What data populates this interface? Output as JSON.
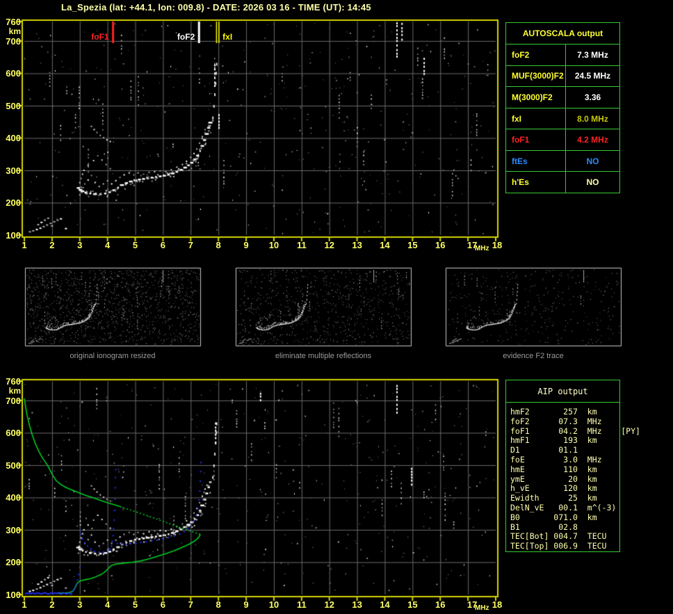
{
  "title": "La_Spezia (lat: +44.1, lon: 009.8) - DATE: 2026 03 16 - TIME (UT): 14:45",
  "palette": {
    "background": "#000000",
    "title_text": "#ffffa8",
    "axis_text": "#ffff66",
    "plot_border": "#d4d400",
    "grid": "#6b6b6b",
    "table_border": "#33cc33",
    "trace_white": "#ffffff",
    "profile_green": "#00cc22",
    "restored_blue": "#2233ff",
    "foF1_red": "#ff2222",
    "ftEs_blue": "#2d8cff"
  },
  "autoscala": {
    "title": "AUTOSCALA output",
    "rows": [
      {
        "label": "foF2",
        "value": "7.3 MHz",
        "label_color": "#ffff33",
        "value_color": "#ffffff"
      },
      {
        "label": "MUF(3000)F2",
        "value": "24.5 MHz",
        "label_color": "#ffff33",
        "value_color": "#ffffff"
      },
      {
        "label": "M(3000)F2",
        "value": "3.36",
        "label_color": "#ffff33",
        "value_color": "#ffffff"
      },
      {
        "label": "fxI",
        "value": "8.0 MHz",
        "label_color": "#ffff33",
        "value_color": "#c8c800"
      },
      {
        "label": "foF1",
        "value": "4.2 MHz",
        "label_color": "#ff2222",
        "value_color": "#ff2222"
      },
      {
        "label": "ftEs",
        "value": "NO",
        "label_color": "#2d8cff",
        "value_color": "#2d8cff"
      },
      {
        "label": "h'Es",
        "value": "NO",
        "label_color": "#ffff33",
        "value_color": "#ffffaa"
      }
    ]
  },
  "aip": {
    "title": "AIP output",
    "rows": [
      {
        "label": "hmF2",
        "value": "257",
        "unit": "km",
        "extra": ""
      },
      {
        "label": "foF2",
        "value": "07.3",
        "unit": "MHz",
        "extra": ""
      },
      {
        "label": "foF1",
        "value": "04.2",
        "unit": "MHz",
        "extra": "[PY]"
      },
      {
        "label": "hmF1",
        "value": "193",
        "unit": "km",
        "extra": ""
      },
      {
        "label": "D1",
        "value": "01.1",
        "unit": "",
        "extra": ""
      },
      {
        "label": "foE",
        "value": "3.0",
        "unit": "MHz",
        "extra": ""
      },
      {
        "label": "hmE",
        "value": "110",
        "unit": "km",
        "extra": ""
      },
      {
        "label": "ymE",
        "value": "20",
        "unit": "km",
        "extra": ""
      },
      {
        "label": "h_vE",
        "value": "120",
        "unit": "km",
        "extra": ""
      },
      {
        "label": "Ewidth",
        "value": "25",
        "unit": "km",
        "extra": ""
      },
      {
        "label": "DelN_vE",
        "value": "00.1",
        "unit": "m^(-3)",
        "extra": ""
      },
      {
        "label": "B0",
        "value": "071.0",
        "unit": "km",
        "extra": ""
      },
      {
        "label": "B1",
        "value": "02.8",
        "unit": "",
        "extra": ""
      },
      {
        "label": "TEC[Bot]",
        "value": "004.7",
        "unit": "TECU",
        "extra": ""
      },
      {
        "label": "TEC[Top]",
        "value": "006.9",
        "unit": "TECU",
        "extra": ""
      }
    ]
  },
  "thumbnails": [
    {
      "caption": "original ionogram resized",
      "noise_level": "high"
    },
    {
      "caption": "eliminate multiple reflections",
      "noise_level": "medium"
    },
    {
      "caption": "evidence F2 trace",
      "noise_level": "low"
    }
  ],
  "chart_data": [
    {
      "id": "top-ionogram",
      "type": "scatter",
      "title": "",
      "xlabel": "MHz",
      "ylabel": "km",
      "xlim": [
        1,
        18
      ],
      "ylim": [
        100,
        760
      ],
      "grid": true,
      "xticks": [
        "1",
        "2",
        "3",
        "4",
        "5",
        "6",
        "7",
        "8",
        "9",
        "10",
        "11",
        "12",
        "13",
        "14",
        "15",
        "16",
        "17",
        "18"
      ],
      "yticks": [
        "760",
        "700",
        "600",
        "500",
        "400",
        "300",
        "200",
        "100"
      ],
      "markers": [
        {
          "label": "foF1",
          "x": 4.2,
          "color": "#ff2222"
        },
        {
          "label": "foF2",
          "x": 7.3,
          "color": "#ffffff"
        },
        {
          "label": "fxI",
          "x": 8.0,
          "color": "#ffff00"
        }
      ],
      "trace_f": [
        [
          2.95,
          246
        ],
        [
          3.02,
          240
        ],
        [
          3.1,
          236
        ],
        [
          3.22,
          232
        ],
        [
          3.38,
          229
        ],
        [
          3.55,
          227
        ],
        [
          3.75,
          227
        ],
        [
          3.92,
          229
        ],
        [
          4.08,
          233
        ],
        [
          4.22,
          239
        ],
        [
          4.38,
          247
        ],
        [
          4.52,
          255
        ],
        [
          4.68,
          261
        ],
        [
          4.84,
          266
        ],
        [
          5.0,
          270
        ],
        [
          5.15,
          272
        ],
        [
          5.3,
          274
        ],
        [
          5.45,
          276
        ],
        [
          5.6,
          278
        ],
        [
          5.75,
          280
        ],
        [
          5.9,
          282
        ],
        [
          6.05,
          284
        ],
        [
          6.2,
          287
        ],
        [
          6.35,
          291
        ],
        [
          6.5,
          296
        ],
        [
          6.65,
          302
        ],
        [
          6.8,
          309
        ],
        [
          6.92,
          316
        ],
        [
          7.04,
          324
        ],
        [
          7.15,
          334
        ],
        [
          7.25,
          346
        ],
        [
          7.34,
          360
        ],
        [
          7.42,
          376
        ],
        [
          7.5,
          394
        ],
        [
          7.58,
          413
        ],
        [
          7.65,
          432
        ],
        [
          7.71,
          448
        ]
      ],
      "trace_spread": [
        [
          3.0,
          262
        ],
        [
          3.05,
          275
        ],
        [
          3.1,
          288
        ],
        [
          3.18,
          258
        ],
        [
          3.3,
          270
        ],
        [
          3.42,
          284
        ],
        [
          3.55,
          262
        ],
        [
          3.7,
          250
        ],
        [
          3.85,
          258
        ],
        [
          4.0,
          268
        ],
        [
          4.15,
          258
        ],
        [
          4.3,
          268
        ],
        [
          4.45,
          278
        ],
        [
          4.6,
          286
        ],
        [
          4.78,
          292
        ],
        [
          4.95,
          286
        ],
        [
          5.1,
          292
        ],
        [
          5.3,
          288
        ],
        [
          5.5,
          294
        ],
        [
          5.7,
          296
        ],
        [
          5.9,
          298
        ],
        [
          6.1,
          296
        ],
        [
          6.3,
          302
        ],
        [
          6.5,
          310
        ],
        [
          6.7,
          318
        ],
        [
          6.85,
          328
        ],
        [
          7.0,
          340
        ],
        [
          7.12,
          352
        ],
        [
          7.22,
          366
        ],
        [
          7.32,
          384
        ],
        [
          7.42,
          404
        ],
        [
          7.52,
          426
        ],
        [
          3.15,
          300
        ],
        [
          3.3,
          315
        ],
        [
          3.5,
          330
        ],
        [
          3.65,
          345
        ],
        [
          3.8,
          332
        ],
        [
          3.95,
          318
        ],
        [
          4.1,
          305
        ]
      ],
      "trace_arc": [
        [
          3.42,
          436
        ],
        [
          3.52,
          426
        ],
        [
          3.62,
          417
        ],
        [
          3.74,
          408
        ],
        [
          3.86,
          401
        ],
        [
          3.98,
          394
        ],
        [
          4.1,
          389
        ]
      ],
      "trace_e": [
        [
          1.2,
          110
        ],
        [
          1.32,
          113
        ],
        [
          1.45,
          117
        ],
        [
          1.58,
          121
        ],
        [
          1.7,
          126
        ],
        [
          1.82,
          131
        ],
        [
          1.95,
          136
        ],
        [
          2.08,
          141
        ],
        [
          2.2,
          146
        ],
        [
          2.32,
          150
        ],
        [
          1.5,
          132
        ],
        [
          1.62,
          139
        ],
        [
          1.74,
          146
        ],
        [
          1.86,
          152
        ],
        [
          2.0,
          128
        ],
        [
          2.5,
          120
        ]
      ],
      "trace_xasym": [
        [
          7.8,
          462
        ],
        [
          7.84,
          498
        ],
        [
          7.87,
          534
        ],
        [
          7.9,
          568
        ],
        [
          7.92,
          600
        ],
        [
          7.94,
          628
        ]
      ],
      "streaks": [
        {
          "x": 14.44,
          "from": 648,
          "to": 758
        },
        {
          "x": 14.62,
          "from": 700,
          "to": 756
        },
        {
          "x": 15.42,
          "from": 598,
          "to": 648
        },
        {
          "x": 7.87,
          "from": 562,
          "to": 628
        },
        {
          "x": 8.02,
          "from": 430,
          "to": 474
        }
      ]
    },
    {
      "id": "bottom-ionogram",
      "type": "scatter",
      "title": "",
      "xlabel": "MHz",
      "ylabel": "km",
      "xlim": [
        1,
        18
      ],
      "ylim": [
        100,
        760
      ],
      "grid": true,
      "xticks": [
        "1",
        "2",
        "3",
        "4",
        "5",
        "6",
        "7",
        "8",
        "9",
        "10",
        "11",
        "12",
        "13",
        "14",
        "15",
        "16",
        "17",
        "18"
      ],
      "yticks": [
        "760",
        "700",
        "600",
        "500",
        "400",
        "300",
        "200",
        "100"
      ],
      "uses_trace_of": "top-ionogram",
      "streaks": [
        {
          "x": 14.44,
          "from": 660,
          "to": 748
        },
        {
          "x": 14.97,
          "from": 432,
          "to": 492
        },
        {
          "x": 7.9,
          "from": 566,
          "to": 632
        },
        {
          "x": 9.52,
          "from": 694,
          "to": 724
        }
      ],
      "profile_green": {
        "topside_solid": [
          [
            1.0,
            706
          ],
          [
            1.05,
            678
          ],
          [
            1.11,
            650
          ],
          [
            1.19,
            622
          ],
          [
            1.28,
            595
          ],
          [
            1.39,
            568
          ],
          [
            1.52,
            543
          ],
          [
            1.67,
            520
          ],
          [
            1.84,
            499
          ],
          [
            2.03,
            468
          ],
          [
            2.15,
            452
          ],
          [
            2.3,
            441
          ],
          [
            2.5,
            431
          ],
          [
            2.72,
            423
          ],
          [
            2.96,
            415
          ],
          [
            3.2,
            407
          ],
          [
            3.46,
            400
          ],
          [
            3.72,
            392
          ],
          [
            4.0,
            384
          ],
          [
            4.28,
            377
          ],
          [
            4.45,
            372
          ]
        ],
        "topside_dashed": [
          [
            4.45,
            372
          ],
          [
            4.8,
            362
          ],
          [
            5.15,
            352
          ],
          [
            5.5,
            342
          ],
          [
            5.85,
            331
          ],
          [
            6.2,
            320
          ],
          [
            6.55,
            309
          ],
          [
            6.85,
            300
          ],
          [
            7.1,
            293
          ],
          [
            7.25,
            289
          ],
          [
            7.35,
            286
          ]
        ],
        "bottomside": [
          [
            7.35,
            286
          ],
          [
            7.28,
            276
          ],
          [
            7.15,
            266
          ],
          [
            6.95,
            256
          ],
          [
            6.7,
            246
          ],
          [
            6.42,
            236
          ],
          [
            6.12,
            227
          ],
          [
            5.8,
            218
          ],
          [
            5.5,
            210
          ],
          [
            5.2,
            204
          ],
          [
            4.9,
            200
          ],
          [
            4.6,
            197
          ],
          [
            4.3,
            194
          ],
          [
            4.12,
            189
          ],
          [
            4.0,
            178
          ],
          [
            3.88,
            168
          ],
          [
            3.72,
            160
          ],
          [
            3.55,
            154
          ],
          [
            3.38,
            149
          ],
          [
            3.2,
            146
          ],
          [
            3.05,
            143
          ],
          [
            2.95,
            139
          ],
          [
            2.89,
            132
          ],
          [
            2.85,
            125
          ],
          [
            2.81,
            118
          ],
          [
            2.77,
            112
          ],
          [
            2.7,
            108
          ],
          [
            2.6,
            106
          ],
          [
            2.45,
            105
          ],
          [
            2.3,
            104
          ],
          [
            2.18,
            104
          ]
        ]
      },
      "trace_blue": {
        "e_flat": {
          "from": 1.02,
          "to": 2.72,
          "km": 106
        },
        "e_rise": [
          [
            2.76,
            111
          ],
          [
            2.8,
            116
          ],
          [
            2.84,
            123
          ],
          [
            2.88,
            132
          ],
          [
            2.92,
            145
          ],
          [
            2.96,
            162
          ],
          [
            3.0,
            184
          ]
        ],
        "f_hook": [
          [
            3.0,
            298
          ],
          [
            3.04,
            286
          ],
          [
            3.1,
            272
          ],
          [
            3.18,
            260
          ],
          [
            3.28,
            250
          ],
          [
            3.4,
            241
          ],
          [
            3.54,
            234
          ],
          [
            3.7,
            231
          ],
          [
            3.86,
            231
          ],
          [
            4.0,
            234
          ],
          [
            4.1,
            240
          ]
        ],
        "f1_cusp": [
          [
            4.14,
            250
          ],
          [
            4.17,
            264
          ],
          [
            4.2,
            282
          ],
          [
            4.22,
            304
          ],
          [
            4.24,
            330
          ],
          [
            4.26,
            360
          ],
          [
            4.27,
            395
          ],
          [
            4.28,
            430
          ],
          [
            4.29,
            462
          ],
          [
            4.3,
            486
          ]
        ],
        "f2_branch": [
          [
            4.35,
            258
          ],
          [
            4.5,
            256
          ],
          [
            4.66,
            255
          ],
          [
            4.84,
            257
          ],
          [
            5.02,
            259
          ],
          [
            5.2,
            261
          ],
          [
            5.4,
            263
          ],
          [
            5.6,
            266
          ],
          [
            5.8,
            269
          ],
          [
            6.0,
            272
          ],
          [
            6.2,
            276
          ],
          [
            6.4,
            281
          ],
          [
            6.6,
            287
          ],
          [
            6.76,
            294
          ],
          [
            6.9,
            303
          ],
          [
            7.02,
            314
          ],
          [
            7.12,
            328
          ],
          [
            7.2,
            345
          ],
          [
            7.26,
            366
          ],
          [
            7.3,
            392
          ],
          [
            7.33,
            420
          ],
          [
            7.35,
            450
          ],
          [
            7.36,
            480
          ],
          [
            7.37,
            508
          ]
        ]
      }
    }
  ]
}
